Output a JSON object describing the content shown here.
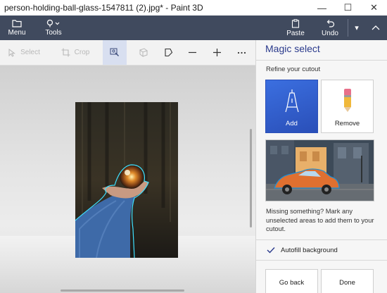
{
  "window": {
    "title": "person-holding-ball-glass-1547811 (2).jpg* - Paint 3D",
    "controls": {
      "minimize": "—",
      "maximize": "☐",
      "close": "✕"
    }
  },
  "ribbon": {
    "menu_label": "Menu",
    "tools_label": "Tools",
    "paste_label": "Paste",
    "undo_label": "Undo",
    "more_glyph": "▾",
    "collapse_glyph": "︿"
  },
  "toolbar": {
    "select_label": "Select",
    "crop_label": "Crop"
  },
  "panel": {
    "title": "Magic select",
    "subtitle": "Refine your cutout",
    "add_label": "Add",
    "remove_label": "Remove",
    "hint": "Missing something? Mark any unselected areas to add them to your cutout.",
    "autofill_label": "Autofill background",
    "autofill_checked": true,
    "go_back_label": "Go back",
    "done_label": "Done"
  },
  "colors": {
    "ribbon": "#404a5e",
    "accent": "#2f5fd0",
    "panel_title": "#2a3a8c"
  }
}
